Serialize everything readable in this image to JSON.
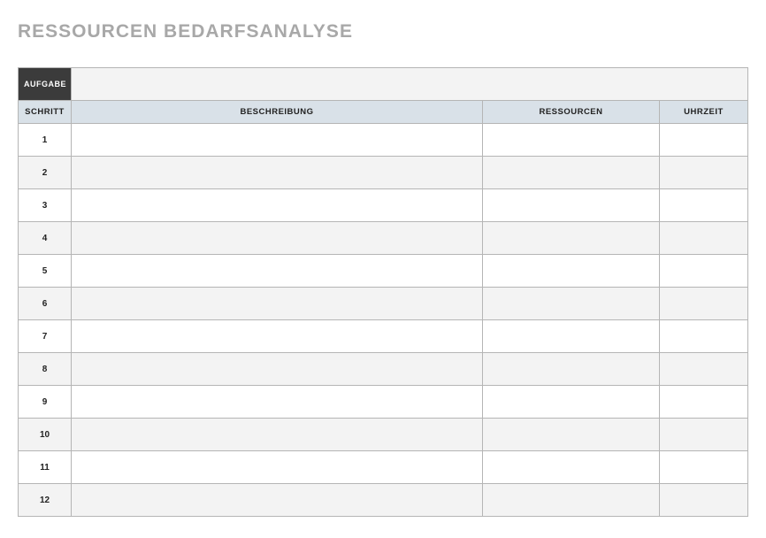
{
  "title": "RESSOURCEN BEDARFSANALYSE",
  "header": {
    "aufgabe_label": "AUFGABE",
    "aufgabe_value": "",
    "schritt": "SCHRITT",
    "beschreibung": "BESCHREIBUNG",
    "ressourcen": "RESSOURCEN",
    "uhrzeit": "UHRZEIT"
  },
  "rows": [
    {
      "step": "1",
      "beschreibung": "",
      "ressourcen": "",
      "uhrzeit": ""
    },
    {
      "step": "2",
      "beschreibung": "",
      "ressourcen": "",
      "uhrzeit": ""
    },
    {
      "step": "3",
      "beschreibung": "",
      "ressourcen": "",
      "uhrzeit": ""
    },
    {
      "step": "4",
      "beschreibung": "",
      "ressourcen": "",
      "uhrzeit": ""
    },
    {
      "step": "5",
      "beschreibung": "",
      "ressourcen": "",
      "uhrzeit": ""
    },
    {
      "step": "6",
      "beschreibung": "",
      "ressourcen": "",
      "uhrzeit": ""
    },
    {
      "step": "7",
      "beschreibung": "",
      "ressourcen": "",
      "uhrzeit": ""
    },
    {
      "step": "8",
      "beschreibung": "",
      "ressourcen": "",
      "uhrzeit": ""
    },
    {
      "step": "9",
      "beschreibung": "",
      "ressourcen": "",
      "uhrzeit": ""
    },
    {
      "step": "10",
      "beschreibung": "",
      "ressourcen": "",
      "uhrzeit": ""
    },
    {
      "step": "11",
      "beschreibung": "",
      "ressourcen": "",
      "uhrzeit": ""
    },
    {
      "step": "12",
      "beschreibung": "",
      "ressourcen": "",
      "uhrzeit": ""
    }
  ]
}
